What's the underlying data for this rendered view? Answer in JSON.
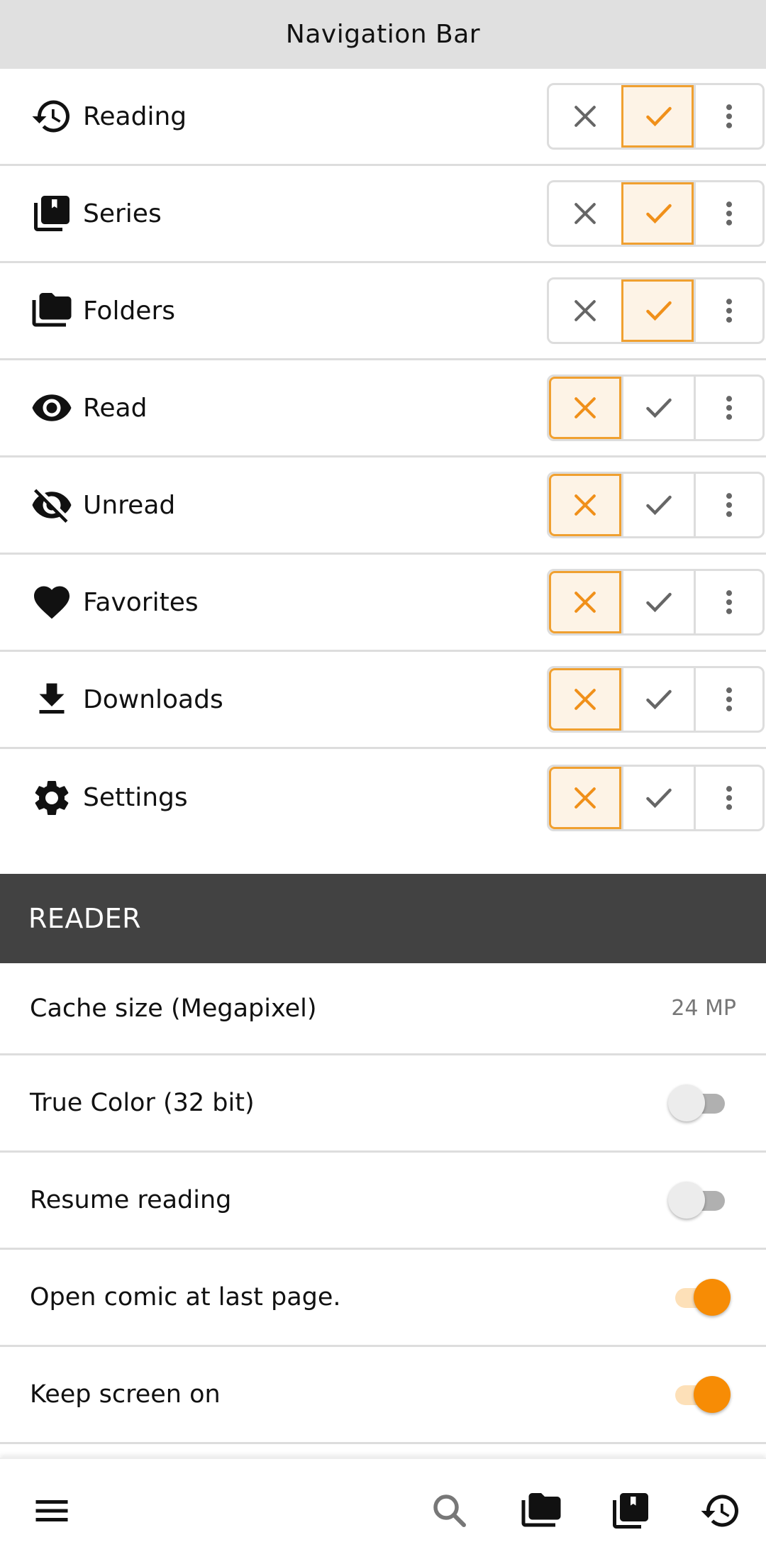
{
  "header": {
    "title": "Navigation Bar"
  },
  "colors": {
    "accent": "#f78c05",
    "accent_border": "#f0a030",
    "section_bg": "#424242",
    "header_bg": "#e0e0e0"
  },
  "nav_items": [
    {
      "label": "Reading",
      "icon": "history-icon",
      "state": "enabled"
    },
    {
      "label": "Series",
      "icon": "library-books-icon",
      "state": "enabled"
    },
    {
      "label": "Folders",
      "icon": "folder-copy-icon",
      "state": "enabled"
    },
    {
      "label": "Read",
      "icon": "eye-icon",
      "state": "disabled"
    },
    {
      "label": "Unread",
      "icon": "eye-off-icon",
      "state": "disabled"
    },
    {
      "label": "Favorites",
      "icon": "heart-icon",
      "state": "disabled"
    },
    {
      "label": "Downloads",
      "icon": "download-icon",
      "state": "disabled"
    },
    {
      "label": "Settings",
      "icon": "gear-icon",
      "state": "disabled"
    }
  ],
  "reader_section": {
    "title": "READER",
    "items": [
      {
        "label": "Cache size (Megapixel)",
        "type": "value",
        "value": "24 MP"
      },
      {
        "label": "True Color (32 bit)",
        "type": "switch",
        "on": false
      },
      {
        "label": "Resume reading",
        "type": "switch",
        "on": false
      },
      {
        "label": "Open comic at last page.",
        "type": "switch",
        "on": true
      },
      {
        "label": "Keep screen on",
        "type": "switch",
        "on": true
      }
    ]
  },
  "bottom_bar": {
    "buttons": [
      "menu-icon",
      "search-icon",
      "folder-copy-icon",
      "library-books-icon",
      "history-icon"
    ]
  }
}
